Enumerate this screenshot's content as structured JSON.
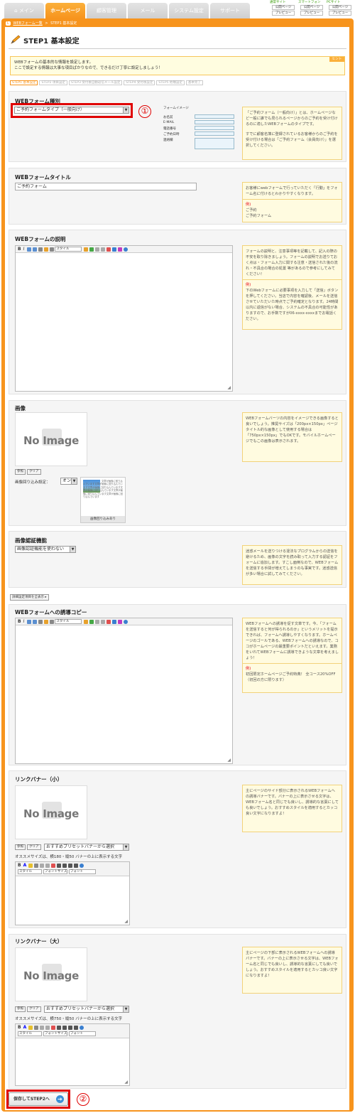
{
  "nav": {
    "tabs": [
      {
        "label": "メイン"
      },
      {
        "label": "ホームページ"
      },
      {
        "label": "顧客管理"
      },
      {
        "label": "メール"
      },
      {
        "label": "システム設定"
      },
      {
        "label": "サポート"
      }
    ],
    "preview": [
      {
        "site": "通常サイト",
        "btn1": "公開ページ",
        "btn2": "プレビュー"
      },
      {
        "site": "スマートフォン",
        "btn1": "公開ページ",
        "btn2": "プレビュー"
      },
      {
        "site": "PCサイト",
        "btn1": "公開ページ",
        "btn2": "プレビュー"
      }
    ]
  },
  "breadcrumb": {
    "icon": "L",
    "parent": "WEBフォーム一覧",
    "sep": ">",
    "current": "STEP1 基本設定"
  },
  "page": {
    "title": "STEP1 基本設定",
    "notice_line1": "WEBフォームの基本的な情報を設定します。",
    "notice_line2": "ここで設定する情報は大事な項目ばかりなので、できるだけ丁寧に設定しましょう！",
    "hint_label": "ヒント"
  },
  "steps": [
    "STEP1 基本設定",
    "STEP2 項目設定",
    "STEP3 受付後自動返信メール設定",
    "STEP4 受付後設定",
    "STEP5 他種設定",
    "基本完了"
  ],
  "form_type": {
    "heading": "WEBフォーム種別",
    "value": "ご予約フォームタイプ（一般向け）",
    "image_title": "フォームイメージ",
    "image_rows": [
      "お名前",
      "E-MAIL",
      "電話番号",
      "ご予約日時",
      "連絡欄"
    ],
    "help_p1": "「ご予約フォーム（一般向け）」とは、ホームページなど一般に誰でも見られるページからのご予約を受け付けるのに適したWEBフォームのタイプです。",
    "help_p2": "すでに顧客名簿に登録されているお客様からのご予約を受け付ける場合は「ご予約フォーム（会員向け）」を選択してください。"
  },
  "form_title": {
    "heading": "WEBフォームタイトル",
    "value": "ご予約フォーム",
    "help": "お客様にwebフォームで行っていただく「行動」をフォーム名に付けるとわかりやすくなります。",
    "ex_label": "例)",
    "ex_1": "ご予約",
    "ex_2": "ご予約フォーム"
  },
  "form_desc": {
    "heading": "WEBフォームの説明",
    "style_label": "スタイル",
    "help": "フォームの説明と、注意事項等を記載して、記入の際の不安を取り除きましょう。フォームの説明でお送りておく点は・フォーム入力に関する注意・送信された後の流れ・不具合の場合の処置 等があるので参考にしてみてください！",
    "ex_label": "例)",
    "ex_text": "下のWebフォームに必要事項を入力して「送信」ボタンを押してください。当店で内容を確認後、メールを送信させていただいた時点でご予約確定となります。24時間以内に返信がない場合、システムの不具合の可能性がありますので、お手数ですが06-xxxx-xxxxまでお電話ください。"
  },
  "image": {
    "heading": "画像",
    "no_image": "No Image",
    "btn_browse": "参照",
    "btn_clear": "クリア",
    "wrap_label": "画像回り込み設定：",
    "wrap_value": "オン",
    "wrap_preview_text": "文章が画像に回り込んでいます文章が画像に回り込んでいます文章が画像に回り込んでいます文章が画像に回り込んでいます文章が画像に回り込んでいます文章が画像に回り込んでいます",
    "wrap_preview_caption": "画像回り込みあり",
    "help": "WEBフォームバーツの内容をイメージできる画像すると良いでしょう。推奨サイズは「200px×150px」ページタイトル的な画像として使用する場合は「750px×150px」でもOKです。モバイルホームページでもこの画像は表示されます。"
  },
  "captcha": {
    "heading": "画像認証機能",
    "value": "画像認証機能を使わない",
    "help": "迷惑メールを送りつける違法なプログラムからの送信を避けるため、画像の文字を読み取って入力する認証をフォームに追加します。すこし面倒なので、WEBフォームを送信する手間が増えてしまうのも事実です。迷惑送信が多い場合に試してみてください。"
  },
  "detail_toggle": "詳細設定項目を全表示 ▸",
  "lead_copy": {
    "heading": "WEBフォームへの誘導コピー",
    "style_label": "スタイル",
    "help": "WEBフォームへの誘導を促す文章です。今、「フォームを送信すると何が得られるのか」というメリットを提示できれば、フォームへ誘導しやすくなります。ホームページのゴールである、WEBフォームへの誘導なので、ココがホームページの最重要ポイントだといえます。業務をいれてWEBフォームに誘導できような文章を考えましょう！",
    "ex_label": "例)",
    "ex_text": "初回限定ホームページご予約特典！ 全コース20%OFF（初回の方に限ります）"
  },
  "banner_small": {
    "heading": "リンクバナー（小）",
    "no_image": "No Image",
    "btn_browse": "参照",
    "btn_clear": "クリア",
    "preset": "おすすめプリセットバナーから選択",
    "size_note": "オススメサイズは、横180・縦50 バナーの上に表示する文字",
    "style_label": "スタイル",
    "fontsize_label": "フォントサイズ",
    "font_label": "フォント",
    "help": "主にページのサイド部分に表示されるWEBフォームへの誘導バナーです。バナーの上に表示させる文字は、WEBフォーム名と同じでも良いし、誘導的な言葉にしても良いでしょう。おすすめスタイルを適用するとカッコ良い文字になりますよ！"
  },
  "banner_large": {
    "heading": "リンクバナー（大）",
    "no_image": "No Image",
    "btn_browse": "参照",
    "btn_clear": "クリア",
    "preset": "おすすめプリセットバナーから選択",
    "size_note": "オススメサイズは、横750・縦50 バナーの上に表示する文字",
    "style_label": "スタイル",
    "fontsize_label": "フォントサイズ",
    "font_label": "フォント",
    "help": "主にページの下部に表示されるWEBフォームへの誘導バナーです。バナーの上に表示させる文字は、WEBフォーム名と同じでも良いし、誘導的な言葉にしても良いでしょう。おすすめスタイルを適用するとカッコ良い文字になりますよ！"
  },
  "footer": {
    "save_label": "保存してSTEP2へ",
    "arrow": "➔"
  },
  "markers": {
    "m1": "①",
    "m2": "②"
  },
  "colors": {
    "accent": "#f7941d",
    "highlight": "#e00000"
  },
  "icons": [
    "home-icon",
    "pencil-icon",
    "arrow-right-icon",
    "camera-icon"
  ]
}
